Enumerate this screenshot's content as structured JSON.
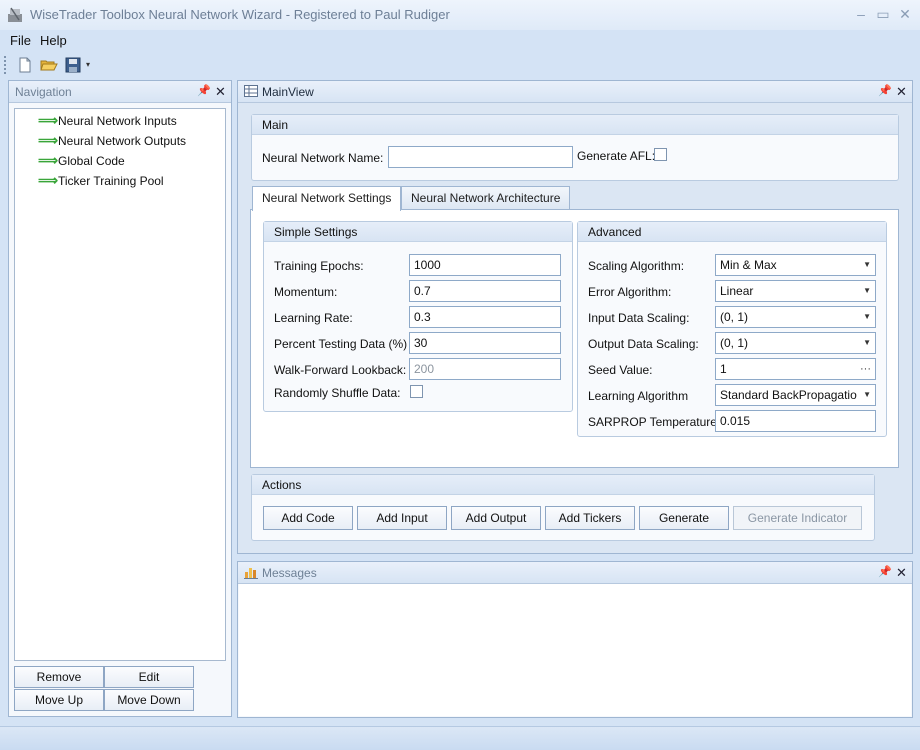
{
  "window": {
    "title": "WiseTrader Toolbox Neural Network Wizard - Registered to Paul Rudiger"
  },
  "menu": {
    "file": "File",
    "help": "Help"
  },
  "toolbar": {
    "icons": [
      "new-file-icon",
      "open-folder-icon",
      "save-icon",
      "toolbar-overflow-icon"
    ]
  },
  "navigation": {
    "title": "Navigation",
    "items": [
      {
        "label": "Neural Network Inputs"
      },
      {
        "label": "Neural Network Outputs"
      },
      {
        "label": "Global Code"
      },
      {
        "label": "Ticker Training Pool"
      }
    ],
    "buttons": {
      "remove": "Remove",
      "edit": "Edit",
      "move_up": "Move Up",
      "move_down": "Move Down"
    }
  },
  "main_view": {
    "title": "MainView",
    "main_group": {
      "title": "Main",
      "name_label": "Neural Network Name:",
      "name_value": "",
      "generate_afl_label": "Generate AFL:",
      "generate_afl_checked": false
    },
    "tabs": [
      {
        "label": "Neural Network Settings",
        "active": true
      },
      {
        "label": "Neural Network Architecture",
        "active": false
      }
    ],
    "simple_settings": {
      "title": "Simple Settings",
      "training_epochs": {
        "label": "Training Epochs:",
        "value": "1000"
      },
      "momentum": {
        "label": "Momentum:",
        "value": "0.7"
      },
      "learning_rate": {
        "label": "Learning Rate:",
        "value": "0.3"
      },
      "percent_testing": {
        "label": "Percent Testing Data (%)",
        "value": "30"
      },
      "walk_forward": {
        "label": "Walk-Forward Lookback:",
        "value": "200"
      },
      "shuffle": {
        "label": "Randomly Shuffle Data:",
        "checked": false
      }
    },
    "advanced": {
      "title": "Advanced",
      "scaling_algorithm": {
        "label": "Scaling Algorithm:",
        "value": "Min & Max"
      },
      "error_algorithm": {
        "label": "Error Algorithm:",
        "value": "Linear"
      },
      "input_scaling": {
        "label": "Input Data Scaling:",
        "value": "(0, 1)"
      },
      "output_scaling": {
        "label": "Output Data Scaling:",
        "value": "(0, 1)"
      },
      "seed_value": {
        "label": "Seed Value:",
        "value": "1"
      },
      "learning_algorithm": {
        "label": "Learning Algorithm",
        "value": "Standard BackPropagatio"
      },
      "sarprop": {
        "label": "SARPROP Temperature",
        "value": "0.015"
      }
    },
    "actions": {
      "title": "Actions",
      "add_code": "Add Code",
      "add_input": "Add Input",
      "add_output": "Add Output",
      "add_tickers": "Add Tickers",
      "generate": "Generate",
      "generate_indicator": "Generate Indicator"
    }
  },
  "messages": {
    "title": "Messages"
  },
  "colors": {
    "accent": "#d4e3f5",
    "nav_arrow": "#3aa53a",
    "border": "#9fb6d2"
  }
}
